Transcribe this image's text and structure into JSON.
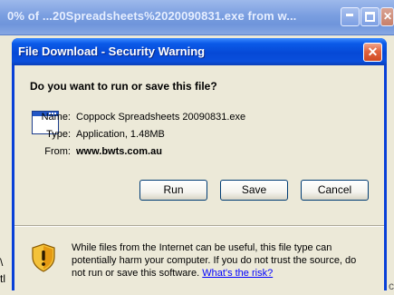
{
  "background_window": {
    "title": "0% of ...20Spreadsheets%2020090831.exe from w...",
    "text_left_1": "\\",
    "text_left_2": "tl",
    "text_right": "c"
  },
  "dialog": {
    "title": "File Download - Security Warning",
    "close_glyph": "✕",
    "question": "Do you want to run or save this file?",
    "fields": {
      "name_label": "Name:",
      "name_value": "Coppock Spreadsheets 20090831.exe",
      "type_label": "Type:",
      "type_value": "Application, 1.48MB",
      "from_label": "From:",
      "from_value": "www.bwts.com.au"
    },
    "buttons": {
      "run": "Run",
      "save": "Save",
      "cancel": "Cancel"
    },
    "warning": {
      "text": "While files from the Internet can be useful, this file type can potentially harm your computer. If you do not trust the source, do not run or save this software.",
      "link": "What's the risk?"
    }
  },
  "icons": {
    "file": "application-file-icon",
    "shield": "security-shield-icon"
  },
  "colors": {
    "titlebar": "#0a4fdc",
    "dialog_bg": "#ece9d8",
    "close_btn": "#e2643f",
    "link": "#0000ff"
  }
}
